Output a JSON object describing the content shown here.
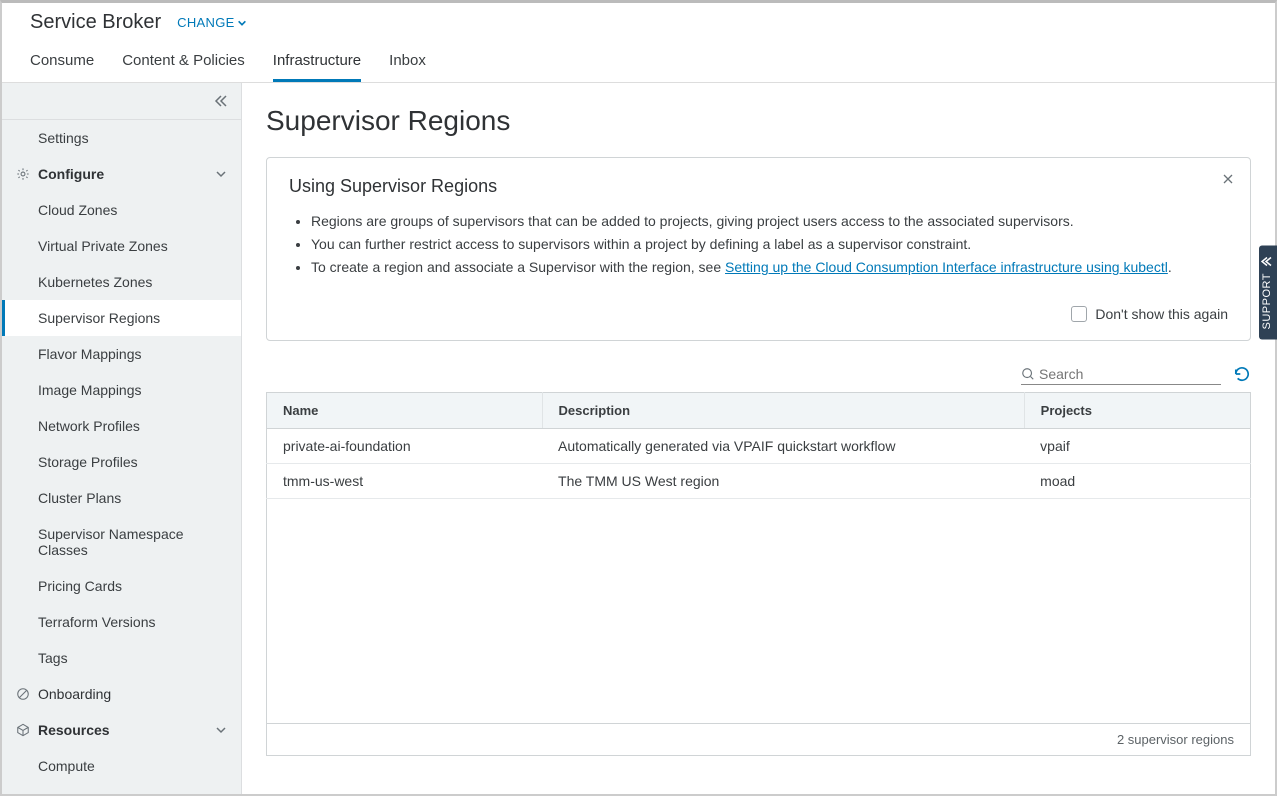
{
  "header": {
    "app_title": "Service Broker",
    "change_label": "CHANGE",
    "tabs": {
      "consume": "Consume",
      "content_policies": "Content & Policies",
      "infrastructure": "Infrastructure",
      "inbox": "Inbox"
    }
  },
  "sidebar": {
    "settings": "Settings",
    "configure": "Configure",
    "configure_items": {
      "cloud_zones": "Cloud Zones",
      "virtual_private_zones": "Virtual Private Zones",
      "kubernetes_zones": "Kubernetes Zones",
      "supervisor_regions": "Supervisor Regions",
      "flavor_mappings": "Flavor Mappings",
      "image_mappings": "Image Mappings",
      "network_profiles": "Network Profiles",
      "storage_profiles": "Storage Profiles",
      "cluster_plans": "Cluster Plans",
      "supervisor_namespace_classes": "Supervisor Namespace Classes",
      "pricing_cards": "Pricing Cards",
      "terraform_versions": "Terraform Versions",
      "tags": "Tags"
    },
    "onboarding": "Onboarding",
    "resources": "Resources",
    "resources_items": {
      "compute": "Compute"
    }
  },
  "main": {
    "page_title": "Supervisor Regions",
    "infobox": {
      "title": "Using Supervisor Regions",
      "bullet1": "Regions are groups of supervisors that can be added to projects, giving project users access to the associated supervisors.",
      "bullet2": "You can further restrict access to supervisors within a project by defining a label as a supervisor constraint.",
      "bullet3_prefix": "To create a region and associate a Supervisor with the region, see ",
      "bullet3_link": "Setting up the Cloud Consumption Interface infrastructure using kubectl",
      "bullet3_suffix": ".",
      "dont_show_label": "Don't show this again"
    },
    "search_placeholder": "Search",
    "table": {
      "columns": {
        "name": "Name",
        "description": "Description",
        "projects": "Projects"
      },
      "rows": [
        {
          "name": "private-ai-foundation",
          "description": "Automatically generated via VPAIF quickstart workflow",
          "projects": "vpaif"
        },
        {
          "name": "tmm-us-west",
          "description": "The TMM US West region",
          "projects": "moad"
        }
      ],
      "footer": "2 supervisor regions"
    }
  },
  "support_tab": "SUPPORT"
}
